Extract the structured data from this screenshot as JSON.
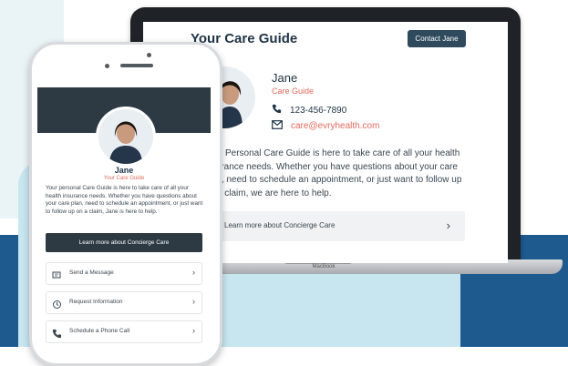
{
  "laptop": {
    "title": "Your Care Guide",
    "contact_button": "Contact Jane",
    "name": "Jane",
    "role": "Care Guide",
    "phone": "123-456-7890",
    "email": "care@evryhealth.com",
    "description": "Your Personal Care Guide is here to take care of all your health insurance needs. Whether you have questions about your care plan, need to schedule an appointment, or just want to follow up on a claim, we are here to help.",
    "learn_more": "Learn more about Concierge Care",
    "brand": "MacBook"
  },
  "phone": {
    "name": "Jane",
    "role": "Your Care Guide",
    "description": "Your personal Care Guide is here to take care of all your health insurance needs. Whether you have questions about your care plan, need to schedule an appointment, or just want to follow up on a claim, Jane is here to help.",
    "cta": "Learn more about Concierge Care",
    "items": [
      {
        "label": "Send a Message",
        "icon": "message-icon"
      },
      {
        "label": "Request Information",
        "icon": "info-clock-icon"
      },
      {
        "label": "Schedule a Phone Call",
        "icon": "phone-icon"
      }
    ]
  },
  "colors": {
    "navy_band": "#1e5a8e",
    "light_panel": "#c8e6ef",
    "dark_header": "#2d3a44",
    "accent": "#e06a5e"
  }
}
